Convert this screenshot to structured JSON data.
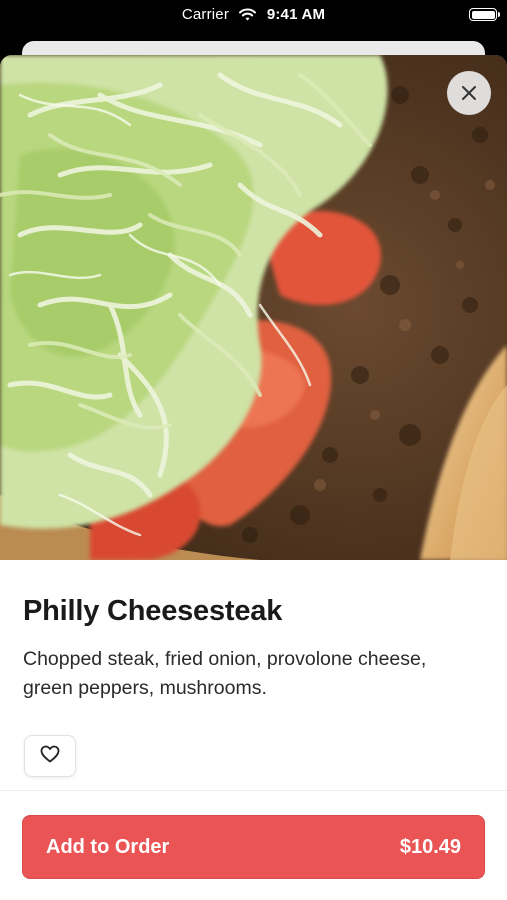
{
  "status_bar": {
    "carrier": "Carrier",
    "time": "9:41 AM",
    "wifi_icon": "wifi-icon",
    "battery_icon": "battery-icon"
  },
  "hero": {
    "image_description": "close-up photo of a Philly cheesesteak sandwich with shredded lettuce, tomato and chopped steak",
    "close_icon": "close-icon"
  },
  "product": {
    "name": "Philly Cheesesteak",
    "description": "Chopped steak, fried onion, provolone cheese, green peppers, mushrooms.",
    "favorite_icon": "heart-outline-icon"
  },
  "order_button": {
    "label": "Add to Order",
    "price": "$10.49"
  },
  "colors": {
    "accent": "#ea5455",
    "text_primary": "#1a1a1a",
    "status_bar_bg": "#000000"
  }
}
